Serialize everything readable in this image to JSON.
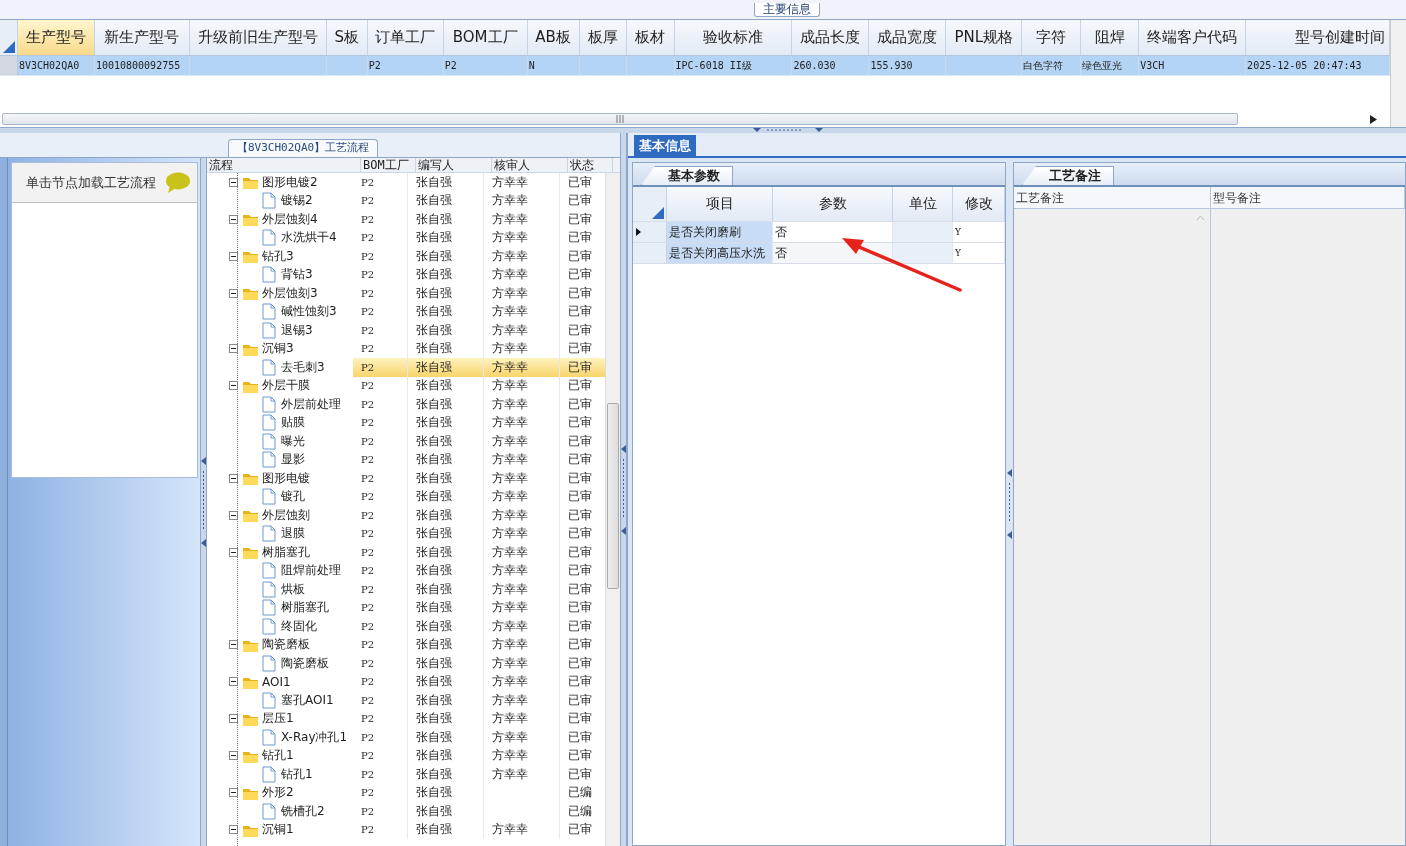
{
  "main_info": {
    "group_title": "主要信息",
    "columns": [
      {
        "label": "生产型号",
        "selected": true
      },
      {
        "label": "新生产型号",
        "selected": false
      },
      {
        "label": "升级前旧生产型号",
        "selected": false
      },
      {
        "label": "S板",
        "selected": false
      },
      {
        "label": "订单工厂",
        "selected": false
      },
      {
        "label": "BOM工厂",
        "selected": false
      },
      {
        "label": "AB板",
        "selected": false
      },
      {
        "label": "板厚",
        "selected": false
      },
      {
        "label": "板材",
        "selected": false
      },
      {
        "label": "验收标准",
        "selected": false
      },
      {
        "label": "成品长度",
        "selected": false
      },
      {
        "label": "成品宽度",
        "selected": false
      },
      {
        "label": "PNL规格",
        "selected": false
      },
      {
        "label": "字符",
        "selected": false
      },
      {
        "label": "阻焊",
        "selected": false
      },
      {
        "label": "终端客户代码",
        "selected": false
      },
      {
        "label": "型号创建时间",
        "selected": false
      }
    ],
    "rows": [
      {
        "selected": true,
        "cells": [
          "8V3CH02QA0",
          "10010800092755",
          null,
          null,
          "P2",
          "P2",
          "N",
          null,
          null,
          "IPC-6018 II级",
          "260.030",
          "155.930",
          null,
          "白色字符",
          "绿色亚光",
          "V3CH",
          "2025-12-05 20:47:43"
        ]
      }
    ]
  },
  "process_flow": {
    "title": "【8V3CH02QA0】工艺流程",
    "hint": "单击节点加载工艺流程",
    "columns": [
      "流程",
      "BOM工厂",
      "编写人",
      "核审人",
      "状态"
    ],
    "nodes": [
      {
        "kind": "folder",
        "name": "图形电镀2",
        "bom": "P2",
        "writer": "张自强",
        "reviewer": "方幸幸",
        "status": "已审",
        "expanded": true,
        "selected": false,
        "children": [
          {
            "kind": "file",
            "name": "镀锡2",
            "bom": "P2",
            "writer": "张自强",
            "reviewer": "方幸幸",
            "status": "已审",
            "selected": false
          }
        ]
      },
      {
        "kind": "folder",
        "name": "外层蚀刻4",
        "bom": "P2",
        "writer": "张自强",
        "reviewer": "方幸幸",
        "status": "已审",
        "expanded": true,
        "selected": false,
        "children": [
          {
            "kind": "file",
            "name": "水洗烘干4",
            "bom": "P2",
            "writer": "张自强",
            "reviewer": "方幸幸",
            "status": "已审",
            "selected": false
          }
        ]
      },
      {
        "kind": "folder",
        "name": "钻孔3",
        "bom": "P2",
        "writer": "张自强",
        "reviewer": "方幸幸",
        "status": "已审",
        "expanded": true,
        "selected": false,
        "children": [
          {
            "kind": "file",
            "name": "背钻3",
            "bom": "P2",
            "writer": "张自强",
            "reviewer": "方幸幸",
            "status": "已审",
            "selected": false
          }
        ]
      },
      {
        "kind": "folder",
        "name": "外层蚀刻3",
        "bom": "P2",
        "writer": "张自强",
        "reviewer": "方幸幸",
        "status": "已审",
        "expanded": true,
        "selected": false,
        "children": [
          {
            "kind": "file",
            "name": "碱性蚀刻3",
            "bom": "P2",
            "writer": "张自强",
            "reviewer": "方幸幸",
            "status": "已审",
            "selected": false
          },
          {
            "kind": "file",
            "name": "退锡3",
            "bom": "P2",
            "writer": "张自强",
            "reviewer": "方幸幸",
            "status": "已审",
            "selected": false
          }
        ]
      },
      {
        "kind": "folder",
        "name": "沉铜3",
        "bom": "P2",
        "writer": "张自强",
        "reviewer": "方幸幸",
        "status": "已审",
        "expanded": true,
        "selected": false,
        "children": [
          {
            "kind": "file",
            "name": "去毛刺3",
            "bom": "P2",
            "writer": "张自强",
            "reviewer": "方幸幸",
            "status": "已审",
            "selected": true
          }
        ]
      },
      {
        "kind": "folder",
        "name": "外层干膜",
        "bom": "P2",
        "writer": "张自强",
        "reviewer": "方幸幸",
        "status": "已审",
        "expanded": true,
        "selected": false,
        "children": [
          {
            "kind": "file",
            "name": "外层前处理",
            "bom": "P2",
            "writer": "张自强",
            "reviewer": "方幸幸",
            "status": "已审",
            "selected": false
          },
          {
            "kind": "file",
            "name": "贴膜",
            "bom": "P2",
            "writer": "张自强",
            "reviewer": "方幸幸",
            "status": "已审",
            "selected": false
          },
          {
            "kind": "file",
            "name": "曝光",
            "bom": "P2",
            "writer": "张自强",
            "reviewer": "方幸幸",
            "status": "已审",
            "selected": false
          },
          {
            "kind": "file",
            "name": "显影",
            "bom": "P2",
            "writer": "张自强",
            "reviewer": "方幸幸",
            "status": "已审",
            "selected": false
          }
        ]
      },
      {
        "kind": "folder",
        "name": "图形电镀",
        "bom": "P2",
        "writer": "张自强",
        "reviewer": "方幸幸",
        "status": "已审",
        "expanded": true,
        "selected": false,
        "children": [
          {
            "kind": "file",
            "name": "镀孔",
            "bom": "P2",
            "writer": "张自强",
            "reviewer": "方幸幸",
            "status": "已审",
            "selected": false
          }
        ]
      },
      {
        "kind": "folder",
        "name": "外层蚀刻",
        "bom": "P2",
        "writer": "张自强",
        "reviewer": "方幸幸",
        "status": "已审",
        "expanded": true,
        "selected": false,
        "children": [
          {
            "kind": "file",
            "name": "退膜",
            "bom": "P2",
            "writer": "张自强",
            "reviewer": "方幸幸",
            "status": "已审",
            "selected": false
          }
        ]
      },
      {
        "kind": "folder",
        "name": "树脂塞孔",
        "bom": "P2",
        "writer": "张自强",
        "reviewer": "方幸幸",
        "status": "已审",
        "expanded": true,
        "selected": false,
        "children": [
          {
            "kind": "file",
            "name": "阻焊前处理",
            "bom": "P2",
            "writer": "张自强",
            "reviewer": "方幸幸",
            "status": "已审",
            "selected": false
          },
          {
            "kind": "file",
            "name": "烘板",
            "bom": "P2",
            "writer": "张自强",
            "reviewer": "方幸幸",
            "status": "已审",
            "selected": false
          },
          {
            "kind": "file",
            "name": "树脂塞孔",
            "bom": "P2",
            "writer": "张自强",
            "reviewer": "方幸幸",
            "status": "已审",
            "selected": false
          },
          {
            "kind": "file",
            "name": "终固化",
            "bom": "P2",
            "writer": "张自强",
            "reviewer": "方幸幸",
            "status": "已审",
            "selected": false
          }
        ]
      },
      {
        "kind": "folder",
        "name": "陶瓷磨板",
        "bom": "P2",
        "writer": "张自强",
        "reviewer": "方幸幸",
        "status": "已审",
        "expanded": true,
        "selected": false,
        "children": [
          {
            "kind": "file",
            "name": "陶瓷磨板",
            "bom": "P2",
            "writer": "张自强",
            "reviewer": "方幸幸",
            "status": "已审",
            "selected": false
          }
        ]
      },
      {
        "kind": "folder",
        "name": "AOI1",
        "bom": "P2",
        "writer": "张自强",
        "reviewer": "方幸幸",
        "status": "已审",
        "expanded": true,
        "selected": false,
        "children": [
          {
            "kind": "file",
            "name": "塞孔AOI1",
            "bom": "P2",
            "writer": "张自强",
            "reviewer": "方幸幸",
            "status": "已审",
            "selected": false
          }
        ]
      },
      {
        "kind": "folder",
        "name": "层压1",
        "bom": "P2",
        "writer": "张自强",
        "reviewer": "方幸幸",
        "status": "已审",
        "expanded": true,
        "selected": false,
        "children": [
          {
            "kind": "file",
            "name": "X-Ray冲孔1",
            "bom": "P2",
            "writer": "张自强",
            "reviewer": "方幸幸",
            "status": "已审",
            "selected": false
          }
        ]
      },
      {
        "kind": "folder",
        "name": "钻孔1",
        "bom": "P2",
        "writer": "张自强",
        "reviewer": "方幸幸",
        "status": "已审",
        "expanded": true,
        "selected": false,
        "children": [
          {
            "kind": "file",
            "name": "钻孔1",
            "bom": "P2",
            "writer": "张自强",
            "reviewer": "方幸幸",
            "status": "已审",
            "selected": false
          }
        ]
      },
      {
        "kind": "folder",
        "name": "外形2",
        "bom": "P2",
        "writer": "张自强",
        "status": "已编",
        "expanded": true,
        "selected": false,
        "children": [
          {
            "kind": "file",
            "name": "铣槽孔2",
            "bom": "P2",
            "writer": "张自强",
            "status": "已编",
            "selected": false
          }
        ]
      },
      {
        "kind": "folder",
        "name": "沉铜1",
        "bom": "P2",
        "writer": "张自强",
        "reviewer": "方幸幸",
        "status": "已审",
        "expanded": true,
        "selected": false
      }
    ]
  },
  "basic_info": {
    "tab": "基本信息",
    "sub_tab": "基本参数",
    "columns": [
      "项目",
      "参数",
      "单位",
      "修改"
    ],
    "rows": [
      {
        "item": "是否关闭磨刷",
        "param": "否",
        "modify": "Y",
        "current": true
      },
      {
        "item": "是否关闭高压水洗",
        "param": "否",
        "modify": "Y",
        "current": false
      }
    ]
  },
  "process_notes": {
    "tab": "工艺备注",
    "columns": [
      "工艺备注",
      "型号备注"
    ]
  }
}
